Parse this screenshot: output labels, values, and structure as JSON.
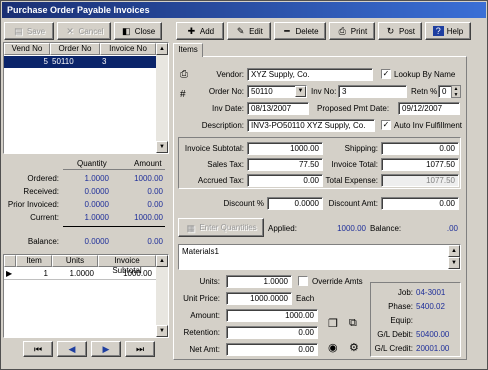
{
  "title": "Purchase Order Payable Invoices",
  "toolbar_left": {
    "save": "Save",
    "cancel": "Cancel",
    "close": "Close"
  },
  "toolbar_right": {
    "add": "Add",
    "edit": "Edit",
    "delete": "Delete",
    "print": "Print",
    "post": "Post",
    "help": "Help"
  },
  "list": {
    "headers": [
      "Vend No",
      "Order No",
      "Invoice No"
    ],
    "rows": [
      {
        "vend": "5",
        "order": "50110",
        "invoice": "3"
      }
    ]
  },
  "summary": {
    "qty_header": "Quantity",
    "amt_header": "Amount",
    "rows": [
      {
        "label": "Ordered:",
        "qty": "1.0000",
        "amt": "1000.00"
      },
      {
        "label": "Received:",
        "qty": "0.0000",
        "amt": "0.00"
      },
      {
        "label": "Prior Invoiced:",
        "qty": "0.0000",
        "amt": "0.00"
      },
      {
        "label": "Current:",
        "qty": "1.0000",
        "amt": "1000.00"
      },
      {
        "label": "Balance:",
        "qty": "0.0000",
        "amt": "0.00"
      }
    ]
  },
  "items_grid": {
    "headers": [
      "Item",
      "Units",
      "Invoice Subtotal"
    ],
    "rows": [
      {
        "item": "1",
        "units": "1.0000",
        "subtotal": "1000.00"
      }
    ]
  },
  "tab": "Items",
  "form": {
    "vendor_label": "Vendor:",
    "vendor": "XYZ Supply, Co.",
    "lookup_label": "Lookup By Name",
    "order_no_label": "Order No:",
    "order_no": "50110",
    "inv_no_label": "Inv No:",
    "inv_no": "3",
    "retn_label": "Retn %",
    "retn": "0",
    "inv_date_label": "Inv Date:",
    "inv_date": "08/13/2007",
    "pmt_date_label": "Proposed Pmt Date:",
    "pmt_date": "09/12/2007",
    "desc_label": "Description:",
    "desc": "INV3-PO50110 XYZ Supply, Co.",
    "auto_label": "Auto Inv Fulfillment"
  },
  "totals": {
    "subtotal_label": "Invoice Subtotal:",
    "subtotal": "1000.00",
    "shipping_label": "Shipping:",
    "shipping": "0.00",
    "salestax_label": "Sales Tax:",
    "salestax": "77.50",
    "invtotal_label": "Invoice Total:",
    "invtotal": "1077.50",
    "accrued_label": "Accrued Tax:",
    "accrued": "0.00",
    "totexp_label": "Total Expense:",
    "totexp": "1077.50"
  },
  "discount": {
    "pct_label": "Discount %",
    "pct": "0.0000",
    "amt_label": "Discount Amt:",
    "amt": "0.00"
  },
  "applied": {
    "enter_qty": "Enter Quantities",
    "applied_label": "Applied:",
    "applied": "1000.00",
    "balance_label": "Balance:",
    "balance": ".00"
  },
  "memo": "Materials1",
  "line": {
    "units_label": "Units:",
    "units": "1.0000",
    "override_label": "Override Amts",
    "price_label": "Unit Price:",
    "price": "1000.0000",
    "each": "Each",
    "amount_label": "Amount:",
    "amount": "1000.00",
    "retention_label": "Retention:",
    "retention": "0.00",
    "netamt_label": "Net Amt:",
    "netamt": "0.00"
  },
  "job": {
    "job_label": "Job:",
    "job": "04-3001",
    "phase_label": "Phase:",
    "phase": "5400.02",
    "equip_label": "Equip:",
    "gldebit_label": "G/L Debit:",
    "gldebit": "50400.00",
    "glcredit_label": "G/L Credit:",
    "glcredit": "20001.00"
  }
}
